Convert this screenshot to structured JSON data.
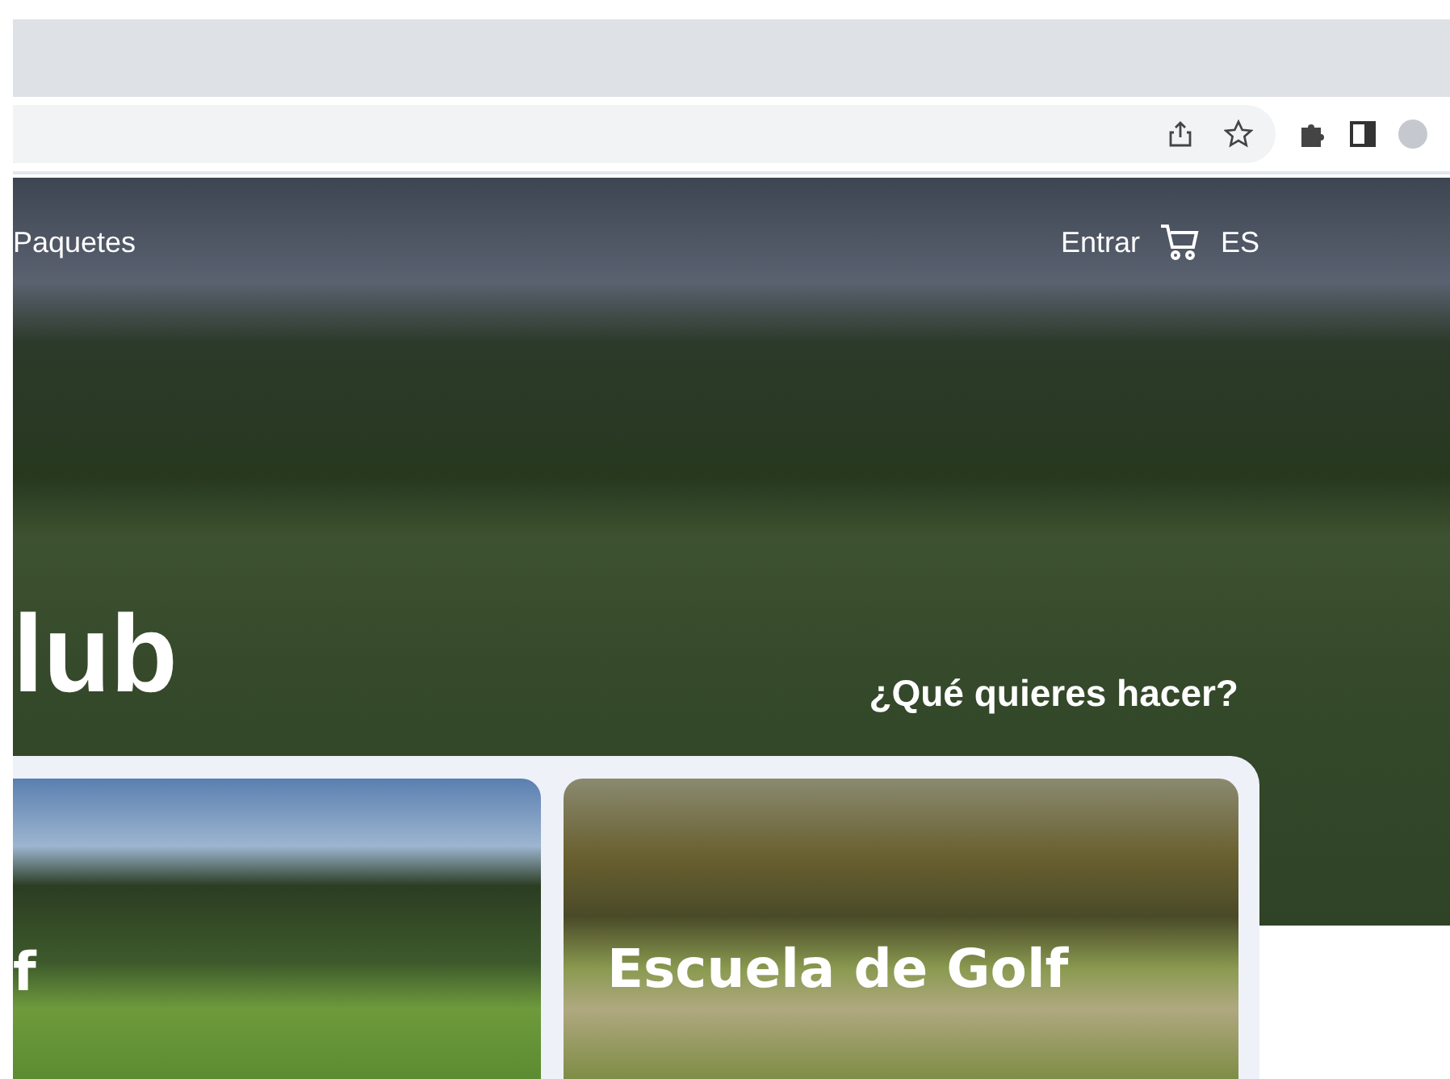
{
  "nav": {
    "links": [
      "Paquetes"
    ],
    "login": "Entrar",
    "language": "ES"
  },
  "hero": {
    "title": "lub",
    "prompt": "¿Qué quieres hacer?"
  },
  "cards": [
    {
      "title": "f"
    },
    {
      "title": "Escuela de Golf"
    }
  ]
}
